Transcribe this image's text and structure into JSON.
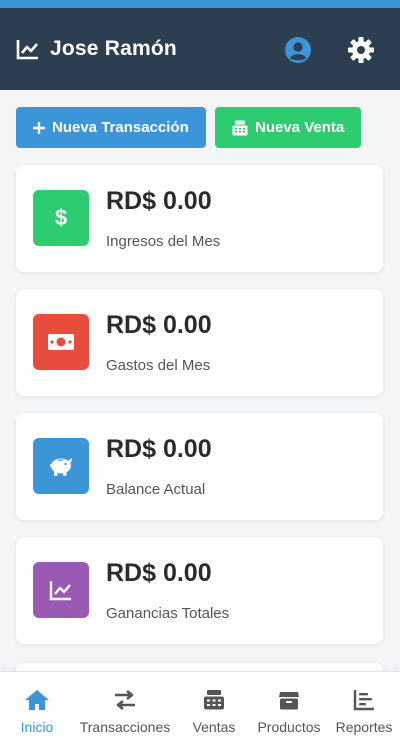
{
  "colors": {
    "header_bg": "#2c3e50",
    "accent": "#3b95d6",
    "success": "#2ecc71",
    "danger": "#e74c3c",
    "purple": "#9b59b6"
  },
  "header": {
    "title": "Jose Ramón",
    "brand_icon": "chart-line-icon",
    "user_icon": "user-circle-icon",
    "settings_icon": "gear-icon"
  },
  "actions": {
    "new_transaction": "Nueva Transacción",
    "new_sale": "Nueva Venta"
  },
  "stats": [
    {
      "amount": "RD$ 0.00",
      "label": "Ingresos del Mes",
      "icon": "dollar-icon",
      "color": "#2ecc71"
    },
    {
      "amount": "RD$ 0.00",
      "label": "Gastos del Mes",
      "icon": "money-bill-icon",
      "color": "#e74c3c"
    },
    {
      "amount": "RD$ 0.00",
      "label": "Balance Actual",
      "icon": "piggy-bank-icon",
      "color": "#3b95d6"
    },
    {
      "amount": "RD$ 0.00",
      "label": "Ganancias Totales",
      "icon": "chart-line-icon",
      "color": "#9b59b6"
    }
  ],
  "nav": {
    "items": [
      {
        "label": "Inicio",
        "icon": "home-icon",
        "active": true
      },
      {
        "label": "Transacciones",
        "icon": "exchange-icon",
        "active": false
      },
      {
        "label": "Ventas",
        "icon": "cash-register-icon",
        "active": false
      },
      {
        "label": "Productos",
        "icon": "box-icon",
        "active": false
      },
      {
        "label": "Reportes",
        "icon": "chart-bar-icon",
        "active": false
      }
    ]
  }
}
